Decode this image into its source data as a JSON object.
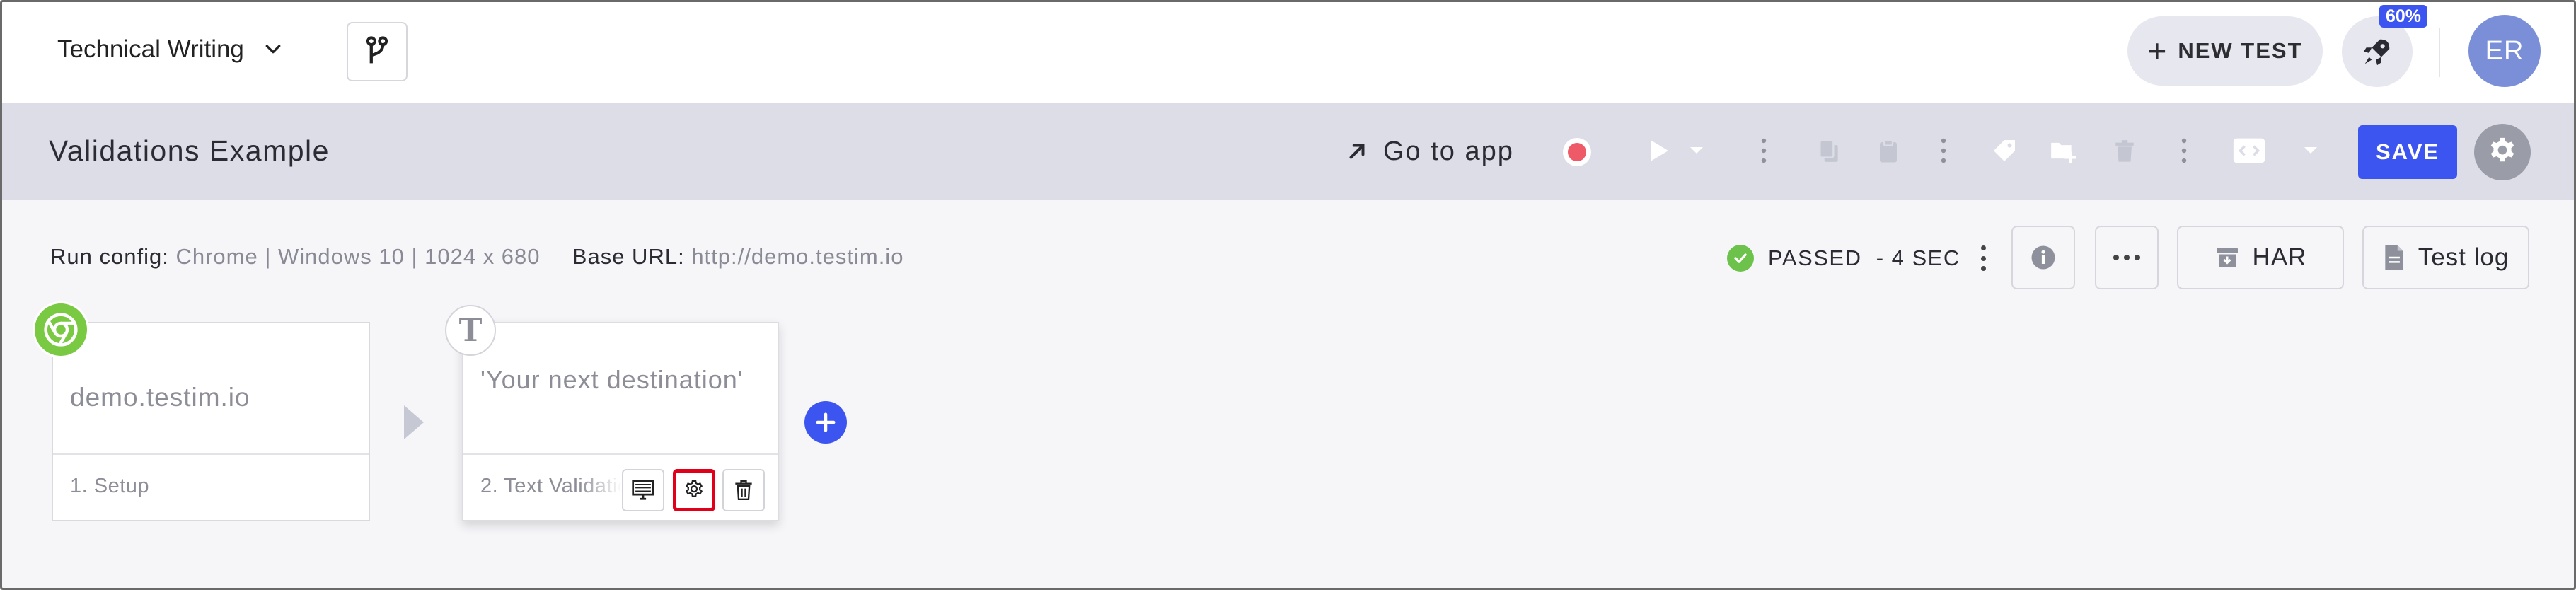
{
  "topbar": {
    "project_name": "Technical Writing",
    "new_test_label": "NEW TEST",
    "progress_badge": "60%",
    "avatar_initials": "ER"
  },
  "test_header": {
    "title": "Validations Example",
    "go_to_app_label": "Go to app",
    "save_label": "SAVE"
  },
  "run_info": {
    "run_config_label": "Run config:",
    "run_config_value": "Chrome | Windows 10 | 1024 x 680",
    "base_url_label": "Base URL:",
    "base_url_value": "http://demo.testim.io",
    "status_text": "PASSED",
    "duration_text": "- 4 SEC",
    "har_label": "HAR",
    "test_log_label": "Test log"
  },
  "steps": [
    {
      "content": "demo.testim.io",
      "label": "1. Setup",
      "icon": "chrome-icon"
    },
    {
      "content": "'Your next destination'",
      "label": "2. Text Validation",
      "icon": "text-icon"
    }
  ],
  "colors": {
    "accent": "#3d55f0",
    "passed": "#6cc24a",
    "record": "#ef5a68",
    "highlight": "#e0001a",
    "header_bg": "#dcdde6"
  }
}
